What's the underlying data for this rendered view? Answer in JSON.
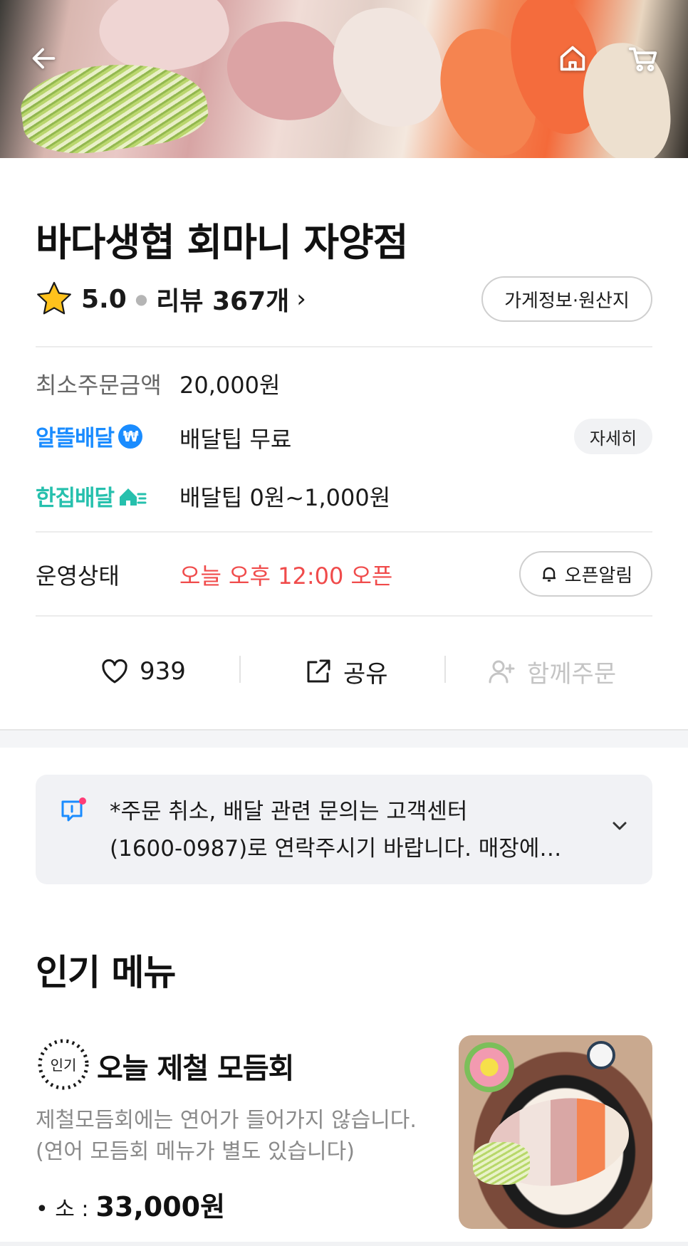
{
  "header": {
    "back_icon": "arrow-left-icon",
    "home_icon": "home-icon",
    "cart_icon": "cart-icon"
  },
  "store": {
    "name": "바다생협 회마니 자양점",
    "rating": "5.0",
    "review_label": "리뷰 367개",
    "info_button": "가게정보·원산지"
  },
  "order_info": {
    "min_order_label": "최소주문금액",
    "min_order_value": "20,000원",
    "baemin_brand": "알뜰배달",
    "baemin_tip": "배달팁 무료",
    "detail_button": "자세히",
    "hanjip_brand": "한집배달",
    "hanjip_tip": "배달팁 0원~1,000원"
  },
  "status": {
    "label": "운영상태",
    "value": "오늘 오후 12:00 오픈",
    "alarm_button": "오픈알림"
  },
  "actions": {
    "like_count": "939",
    "share_label": "공유",
    "group_order_label": "함께주문"
  },
  "notice": {
    "line1": "*주문 취소, 배달 관련 문의는 고객센터",
    "line2": "(1600-0987)로 연락주시기 바랍니다. 매장에…"
  },
  "popular": {
    "title": "인기 메뉴",
    "badge": "인기",
    "item": {
      "name": "오늘 제철 모듬회",
      "desc1": "제철모듬회에는 연어가 들어가지 않습니다.",
      "desc2": "(연어 모듬회 메뉴가 별도 있습니다)",
      "size": "• 소 :",
      "price": "33,000원"
    }
  },
  "colors": {
    "status_red": "#f04b4b",
    "baemin_blue": "#1a8cff",
    "hanjip_teal": "#26c0ad",
    "notice_bg": "#f1f2f5"
  }
}
